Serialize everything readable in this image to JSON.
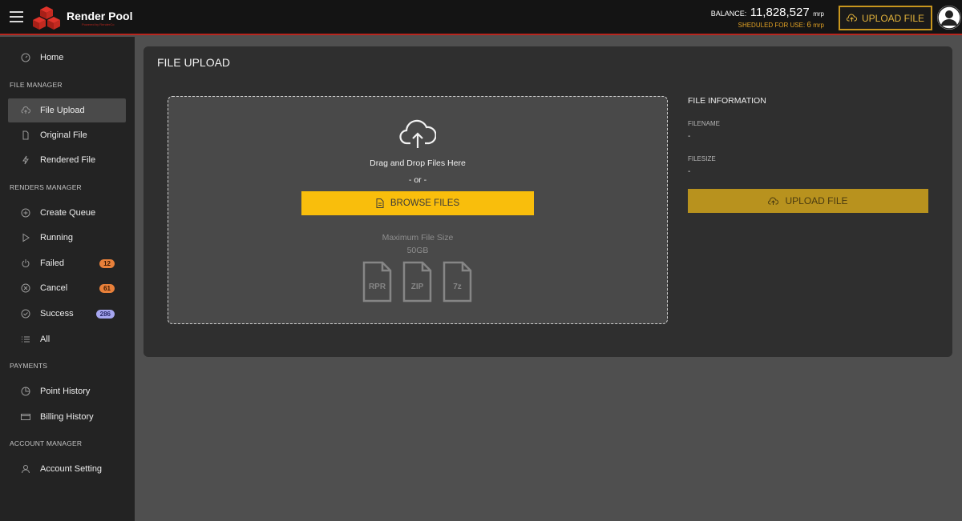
{
  "header": {
    "brand": "Render Pool",
    "brand_sub": "Powered by RenderCo",
    "balance_label": "BALANCE:",
    "balance_value": "11,828,527",
    "balance_unit": "mrp",
    "scheduled_label": "SHEDULED FOR USE:",
    "scheduled_value": "6",
    "scheduled_unit": "mrp",
    "upload_label": "UPLOAD FILE"
  },
  "sidebar": {
    "home": "Home",
    "sections": {
      "file_manager": "FILE MANAGER",
      "renders_manager": "RENDERS MANAGER",
      "payments": "PAYMENTS",
      "account_manager": "ACCOUNT MANAGER"
    },
    "file_manager": [
      "File Upload",
      "Original File",
      "Rendered File"
    ],
    "renders_manager": [
      "Create Queue",
      "Running",
      "Failed",
      "Cancel",
      "Success",
      "All"
    ],
    "badges": {
      "failed": "12",
      "cancel": "61",
      "success": "286"
    },
    "payments": [
      "Point History",
      "Billing History"
    ],
    "account_manager": [
      "Account Setting"
    ]
  },
  "main": {
    "title": "FILE UPLOAD",
    "dropzone": {
      "drag_text": "Drag and Drop Files Here",
      "or_text": "- or -",
      "browse_label": "BROWSE FILES",
      "max_label": "Maximum File Size",
      "max_value": "50GB",
      "file_types": [
        "RPR",
        "ZIP",
        "7z"
      ]
    },
    "info": {
      "title": "FILE INFORMATION",
      "filename_label": "FILENAME",
      "filename_value": "-",
      "filesize_label": "FILESIZE",
      "filesize_value": "-",
      "upload_label": "UPLOAD FILE"
    }
  },
  "colors": {
    "accent_red": "#b8261e",
    "accent_gold": "#c8961e",
    "browse_yellow": "#f9be0c",
    "badge_orange": "#e8803a",
    "badge_purple": "#a6a6f0"
  }
}
